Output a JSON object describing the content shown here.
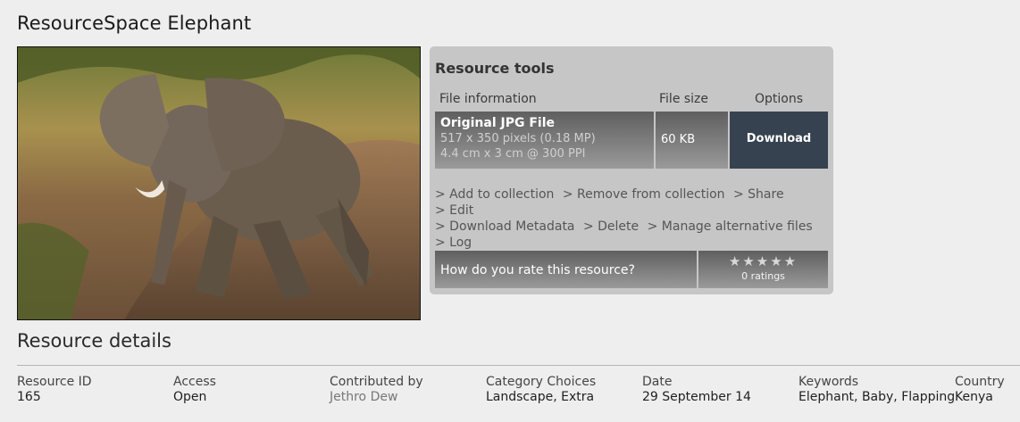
{
  "page": {
    "title": "ResourceSpace Elephant"
  },
  "tools": {
    "title": "Resource tools",
    "headers": {
      "info": "File information",
      "size": "File size",
      "options": "Options"
    },
    "file": {
      "title": "Original JPG File",
      "dimensions": "517 x 350 pixels (0.18 MP)",
      "print_size": "4.4 cm x 3 cm @ 300 PPI",
      "size": "60 KB",
      "download_label": "Download"
    },
    "actions": [
      "> Add to collection",
      "> Remove from collection",
      "> Share",
      "> Edit",
      "> Download Metadata",
      "> Delete",
      "> Manage alternative files",
      "> Log"
    ],
    "rating": {
      "question": "How do you rate this resource?",
      "stars": "★",
      "count": "0 ratings"
    }
  },
  "details": {
    "title": "Resource details",
    "fields": [
      {
        "label": "Resource ID",
        "value": "165"
      },
      {
        "label": "Access",
        "value": "Open"
      },
      {
        "label": "Contributed by",
        "value": "Jethro Dew"
      },
      {
        "label": "Category Choices",
        "value": "Landscape, Extra"
      },
      {
        "label": "Date",
        "value": "29 September 14"
      },
      {
        "label": "Keywords",
        "value": "Elephant, Baby, Flapping"
      },
      {
        "label": "Country",
        "value": "Kenya"
      }
    ]
  }
}
